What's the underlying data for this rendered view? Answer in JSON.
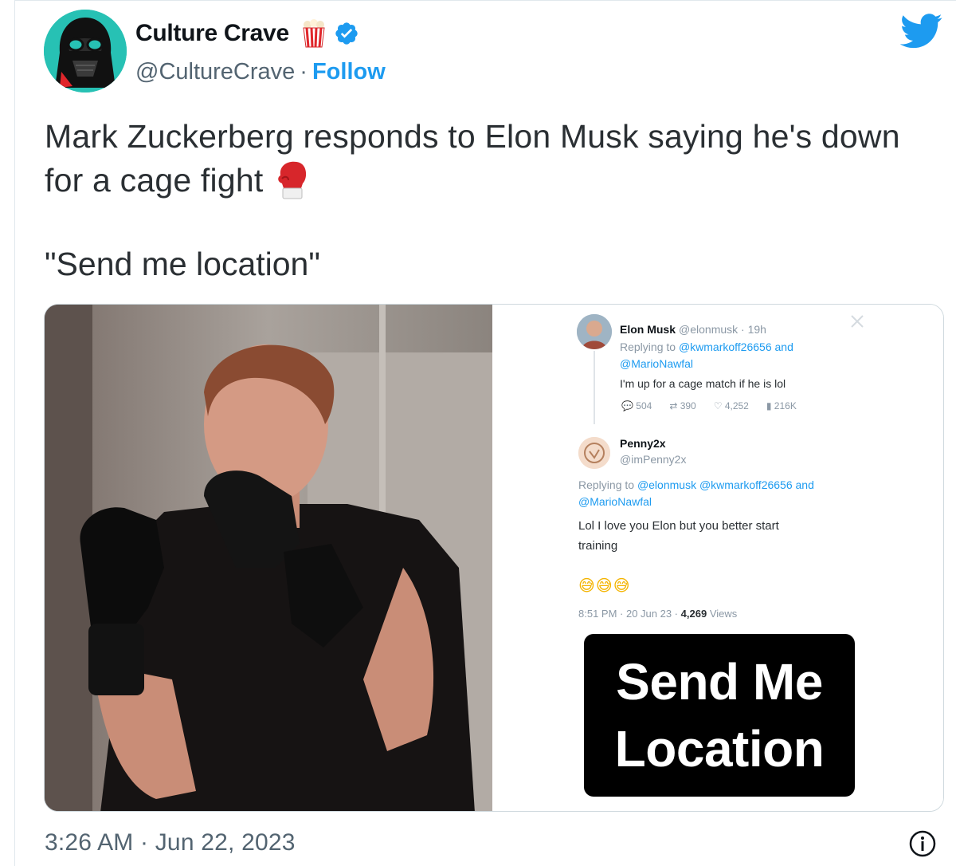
{
  "author": {
    "display_name": "Culture Crave",
    "handle": "@CultureCrave",
    "separator": "·",
    "follow_label": "Follow",
    "name_emoji": "popcorn-icon",
    "verified_icon": "verified-badge-icon"
  },
  "platform_icon": "twitter-bird-icon",
  "tweet": {
    "line1": "Mark Zuckerberg responds to Elon Musk saying he's down",
    "line2": "for a cage fight",
    "emoji": "boxing-glove-icon",
    "quote": "\"Send me location\""
  },
  "media": {
    "screenshot": {
      "tweet1": {
        "name": "Elon Musk",
        "meta": "@elonmusk · 19h",
        "replying_prefix": "Replying to",
        "replying_to": "@kwmarkoff26656 and",
        "replying_to2": "@MarioNawfal",
        "body": "I'm up for a cage match if he is lol",
        "stats": {
          "replies": "504",
          "retweets": "390",
          "likes": "4,252",
          "views": "216K"
        }
      },
      "tweet2": {
        "name": "Penny2x",
        "handle": "@imPenny2x",
        "replying_prefix": "Replying to",
        "replying_to": "@elonmusk @kwmarkoff26656 and",
        "replying_to2": "@MarioNawfal",
        "body_line1": "Lol I love you Elon but you better start",
        "body_line2": "training",
        "emoji": "😅😅😅",
        "time": "8:51 PM · 20 Jun 23 ·",
        "views_count": "4,269",
        "views_label": "Views"
      },
      "overlay_line1": "Send Me",
      "overlay_line2": "Location"
    }
  },
  "timestamp": "3:26 AM · Jun 22, 2023",
  "info_icon": "info-icon",
  "colors": {
    "link_blue": "#1d9bf0",
    "avatar_teal": "#27c1b4",
    "text": "#0f1419",
    "secondary": "#536471"
  }
}
